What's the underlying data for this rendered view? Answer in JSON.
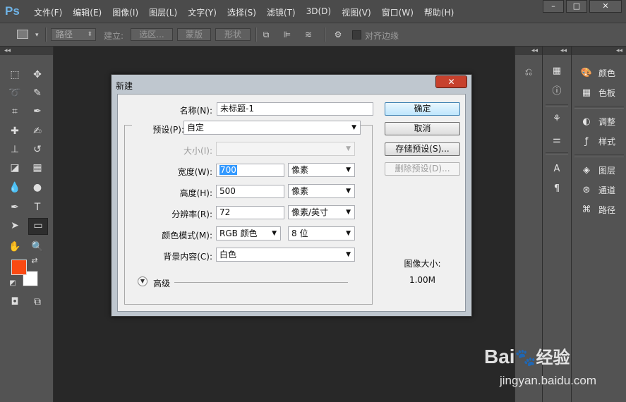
{
  "app": {
    "logo": "Ps"
  },
  "menu": [
    "文件(F)",
    "编辑(E)",
    "图像(I)",
    "图层(L)",
    "文字(Y)",
    "选择(S)",
    "滤镜(T)",
    "3D(D)",
    "视图(V)",
    "窗口(W)",
    "帮助(H)"
  ],
  "window_controls": {
    "minimize": "–",
    "restore": "□",
    "close": "✕"
  },
  "options_bar": {
    "path_mode": "路径",
    "make_label": "建立:",
    "selection_btn": "选区...",
    "mask_btn": "蒙版",
    "shape_btn": "形状",
    "align_edges_label": "对齐边缘"
  },
  "dialog": {
    "title": "新建",
    "close_label": "✕",
    "name_label": "名称(N):",
    "name_value": "未标题-1",
    "preset_label": "预设(P):",
    "preset_value": "自定",
    "size_label": "大小(I):",
    "size_value": "",
    "width_label": "宽度(W):",
    "width_value": "700",
    "width_unit": "像素",
    "height_label": "高度(H):",
    "height_value": "500",
    "height_unit": "像素",
    "resolution_label": "分辨率(R):",
    "resolution_value": "72",
    "resolution_unit": "像素/英寸",
    "color_mode_label": "颜色模式(M):",
    "color_mode_value": "RGB 颜色",
    "bit_depth_value": "8 位",
    "background_label": "背景内容(C):",
    "background_value": "白色",
    "advanced_label": "高级",
    "ok_btn": "确定",
    "cancel_btn": "取消",
    "save_preset_btn": "存储预设(S)...",
    "delete_preset_btn": "删除预设(D)...",
    "image_size_label": "图像大小:",
    "image_size_value": "1.00M"
  },
  "panels": {
    "color": "颜色",
    "swatches": "色板",
    "adjustments": "调整",
    "styles": "样式",
    "layers": "图层",
    "channels": "通道",
    "paths": "路径"
  },
  "colors": {
    "foreground": "#fa4a13",
    "background": "#ffffff"
  },
  "watermark": {
    "brand": "Bai",
    "brand_suffix": "经验",
    "url": "jingyan.baidu.com"
  }
}
